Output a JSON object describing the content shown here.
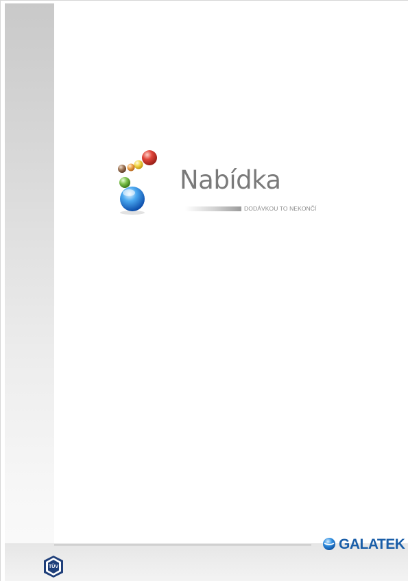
{
  "document": {
    "title": "Nabídka",
    "subtitle": "DODÁVKOU TO NEKONČÍ"
  },
  "brand": {
    "name": "GALATEK",
    "color": "#1a5ea8"
  },
  "certification": {
    "mark_text": "TÜV"
  },
  "colors": {
    "accent_blue": "#1a5ea8",
    "title_gray": "#7a7a7a"
  }
}
